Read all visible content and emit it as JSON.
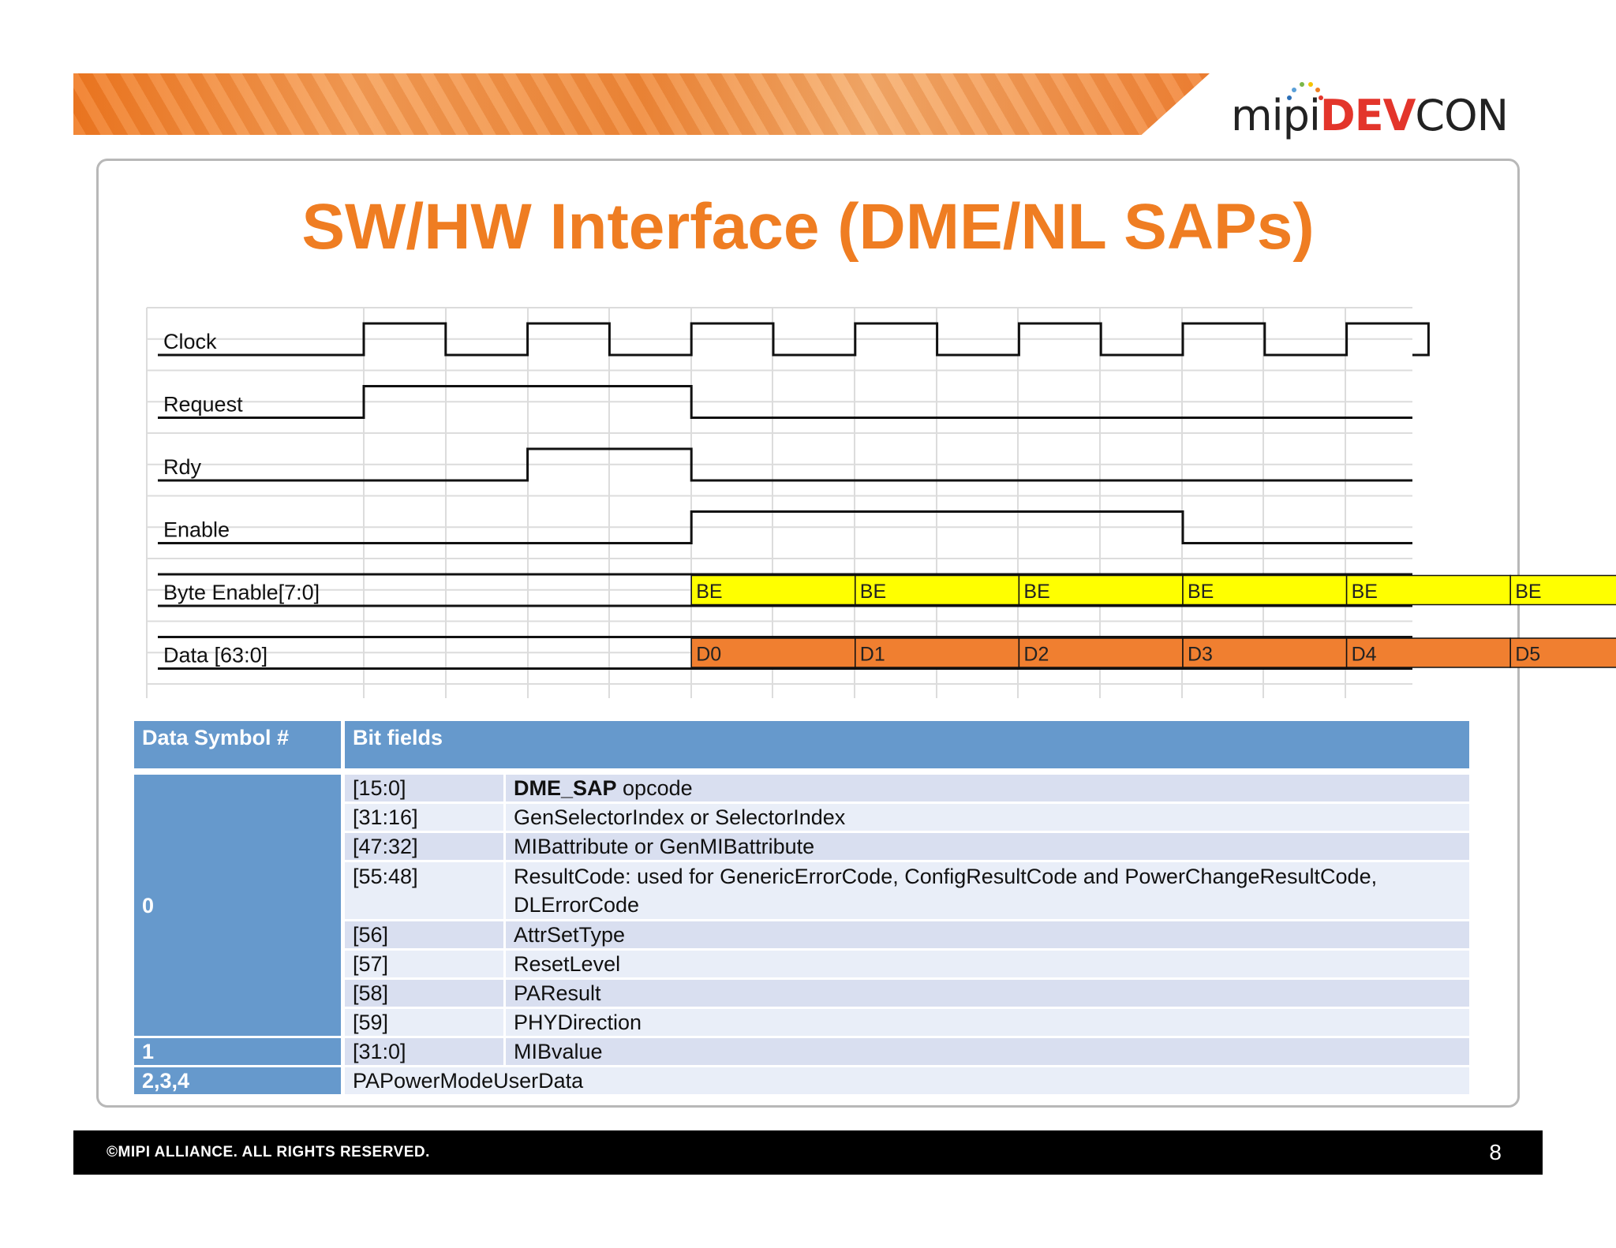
{
  "logo": {
    "mipi": "mipi",
    "dev": "DEV",
    "con": "CON"
  },
  "title": "SW/HW Interface (DME/NL SAPs)",
  "timing": {
    "signals": [
      {
        "label": "Clock",
        "levels": [
          0,
          0,
          0,
          0,
          1,
          0,
          1,
          0,
          1,
          0,
          1,
          0,
          1,
          0,
          1,
          0,
          1,
          0
        ]
      },
      {
        "label": "Request",
        "levels": [
          0,
          0,
          0,
          0,
          1,
          1,
          1,
          1,
          0,
          0,
          0,
          0,
          0,
          0,
          0,
          0,
          0,
          0
        ]
      },
      {
        "label": "Rdy",
        "levels": [
          0,
          0,
          0,
          0,
          0,
          0,
          1,
          1,
          0,
          0,
          0,
          0,
          0,
          0,
          0,
          0,
          0,
          0
        ]
      },
      {
        "label": "Enable",
        "levels": [
          0,
          0,
          0,
          0,
          0,
          0,
          0,
          0,
          1,
          1,
          1,
          1,
          1,
          1,
          0,
          0,
          0,
          0
        ]
      }
    ],
    "buses": [
      {
        "label": "Byte Enable[7:0]",
        "color": "#ffff00",
        "values": [
          "BE",
          "BE",
          "BE",
          "BE",
          "BE",
          "BE"
        ]
      },
      {
        "label": "Data [63:0]",
        "color": "#f07f30",
        "values": [
          "D0",
          "D1",
          "D2",
          "D3",
          "D4",
          "D5"
        ]
      }
    ]
  },
  "table": {
    "headers": [
      "Data Symbol #",
      "Bit fields"
    ],
    "rows": [
      {
        "range": "[15:0]",
        "desc_bold": "DME_SAP",
        "desc": " opcode"
      },
      {
        "range": "[31:16]",
        "desc": "GenSelectorIndex or SelectorIndex"
      },
      {
        "range": "[47:32]",
        "desc": "MIBattribute or GenMIBattribute"
      },
      {
        "range": "[55:48]",
        "desc": "ResultCode: used for GenericErrorCode, ConfigResultCode and PowerChangeResultCode,",
        "desc2": " DLErrorCode"
      },
      {
        "range": "[56]",
        "desc": "AttrSetType"
      },
      {
        "range": "[57]",
        "desc": "ResetLevel"
      },
      {
        "range": "[58]",
        "desc": "PAResult"
      },
      {
        "range": "[59]",
        "desc": "PHYDirection"
      },
      {
        "symbol": "1",
        "range": "[31:0]",
        "desc": "MIBvalue"
      },
      {
        "symbol": "2,3,4",
        "desc": "PAPowerModeUserData"
      }
    ],
    "symbol0": "0"
  },
  "footer": {
    "copyright": "©MIPI ALLIANCE. ALL RIGHTS RESERVED.",
    "page": "8"
  }
}
